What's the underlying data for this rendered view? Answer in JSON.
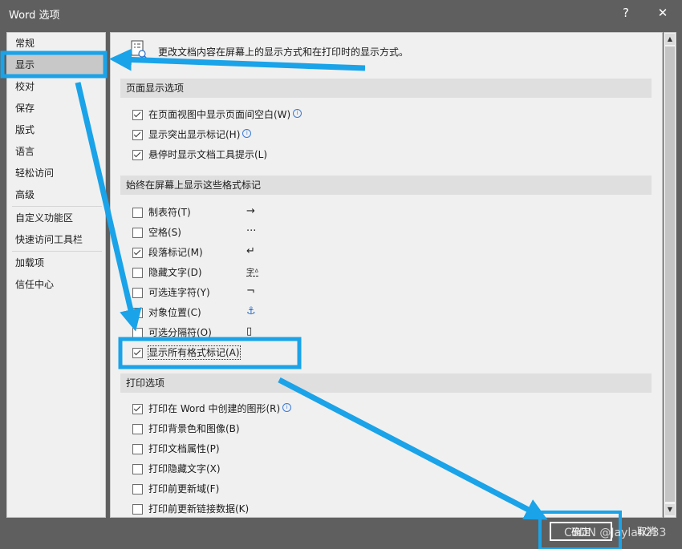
{
  "window": {
    "title": "Word 选项",
    "help_glyph": "?",
    "close_glyph": "✕"
  },
  "sidebar": {
    "items": [
      {
        "label": "常规"
      },
      {
        "label": "显示"
      },
      {
        "label": "校对"
      },
      {
        "label": "保存"
      },
      {
        "label": "版式"
      },
      {
        "label": "语言"
      },
      {
        "label": "轻松访问"
      },
      {
        "label": "高级"
      },
      {
        "label": "自定义功能区"
      },
      {
        "label": "快速访问工具栏"
      },
      {
        "label": "加载项"
      },
      {
        "label": "信任中心"
      }
    ]
  },
  "content": {
    "intro": "更改文档内容在屏幕上的显示方式和在打印时的显示方式。",
    "sections": [
      {
        "heading": "页面显示选项",
        "options": [
          {
            "label": "在页面视图中显示页面间空白(W)",
            "checked": true,
            "info": true
          },
          {
            "label": "显示突出显示标记(H)",
            "checked": true,
            "info": true
          },
          {
            "label": "悬停时显示文档工具提示(L)",
            "checked": true
          }
        ]
      },
      {
        "heading": "始终在屏幕上显示这些格式标记",
        "options": [
          {
            "label": "制表符(T)",
            "checked": false,
            "symbol": "→"
          },
          {
            "label": "空格(S)",
            "checked": false,
            "symbol": "···"
          },
          {
            "label": "段落标记(M)",
            "checked": true,
            "symbol": "↵"
          },
          {
            "label": "隐藏文字(D)",
            "checked": false,
            "symbol": "字ᐞ"
          },
          {
            "label": "可选连字符(Y)",
            "checked": false,
            "symbol": "¬"
          },
          {
            "label": "对象位置(C)",
            "checked": false,
            "symbol": "⚓"
          },
          {
            "label": "可选分隔符(O)",
            "checked": false,
            "symbol": "▯"
          },
          {
            "label": "显示所有格式标记(A)",
            "checked": true
          }
        ]
      },
      {
        "heading": "打印选项",
        "options": [
          {
            "label": "打印在 Word 中创建的图形(R)",
            "checked": true,
            "info": true
          },
          {
            "label": "打印背景色和图像(B)",
            "checked": false
          },
          {
            "label": "打印文档属性(P)",
            "checked": false
          },
          {
            "label": "打印隐藏文字(X)",
            "checked": false
          },
          {
            "label": "打印前更新域(F)",
            "checked": false
          },
          {
            "label": "打印前更新链接数据(K)",
            "checked": false
          }
        ]
      }
    ]
  },
  "buttons": {
    "ok": "确定",
    "cancel": "取消"
  },
  "watermark": "CSDN @Jaylan233",
  "colors": {
    "annotation": "#1aa3e8",
    "dialog_bg": "#f0f0f0",
    "titlebar": "#5f5f5f",
    "selected": "#c8c8c8"
  }
}
